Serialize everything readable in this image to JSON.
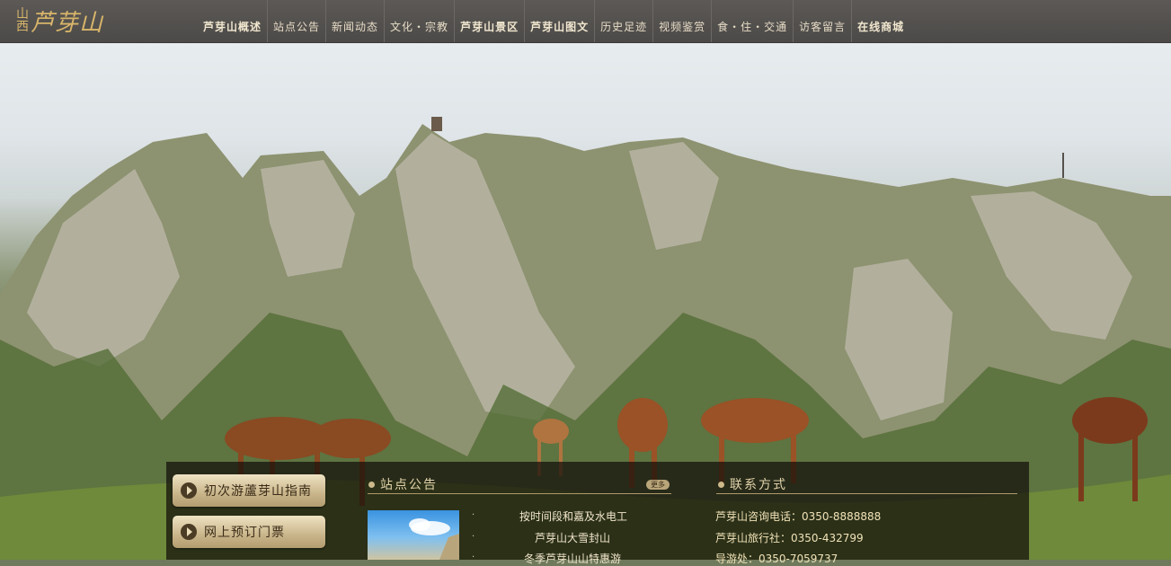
{
  "logo": {
    "small_top": "山",
    "small_bottom": "西",
    "text": "芦芽山"
  },
  "nav": [
    {
      "label": "芦芽山概述",
      "bold": true
    },
    {
      "label": "站点公告",
      "bold": false
    },
    {
      "label": "新闻动态",
      "bold": false
    },
    {
      "label": "文化・宗教",
      "bold": false
    },
    {
      "label": "芦芽山景区",
      "bold": true
    },
    {
      "label": "芦芽山图文",
      "bold": true
    },
    {
      "label": "历史足迹",
      "bold": false
    },
    {
      "label": "视频鉴赏",
      "bold": false
    },
    {
      "label": "食・住・交通",
      "bold": false
    },
    {
      "label": "访客留言",
      "bold": false
    },
    {
      "label": "在线商城",
      "bold": true
    }
  ],
  "sidebar": {
    "guide_label": "初次游蘆芽山指南",
    "ticket_label": "网上预订门票"
  },
  "notices": {
    "title": "站点公告",
    "more_label": "更多",
    "items": [
      "按时间段和嘉及水电工",
      "芦芽山大雪封山",
      "冬季芦芽山山特惠游"
    ]
  },
  "contact": {
    "title": "联系方式",
    "lines": [
      "芦芽山咨询电话：0350-8888888",
      "芦芽山旅行社：0350-432799",
      "导游处：0350-7059737"
    ]
  },
  "colors": {
    "accent": "#d8b56a",
    "panel": "#120e0a",
    "nav_bg": "#524f4d"
  }
}
